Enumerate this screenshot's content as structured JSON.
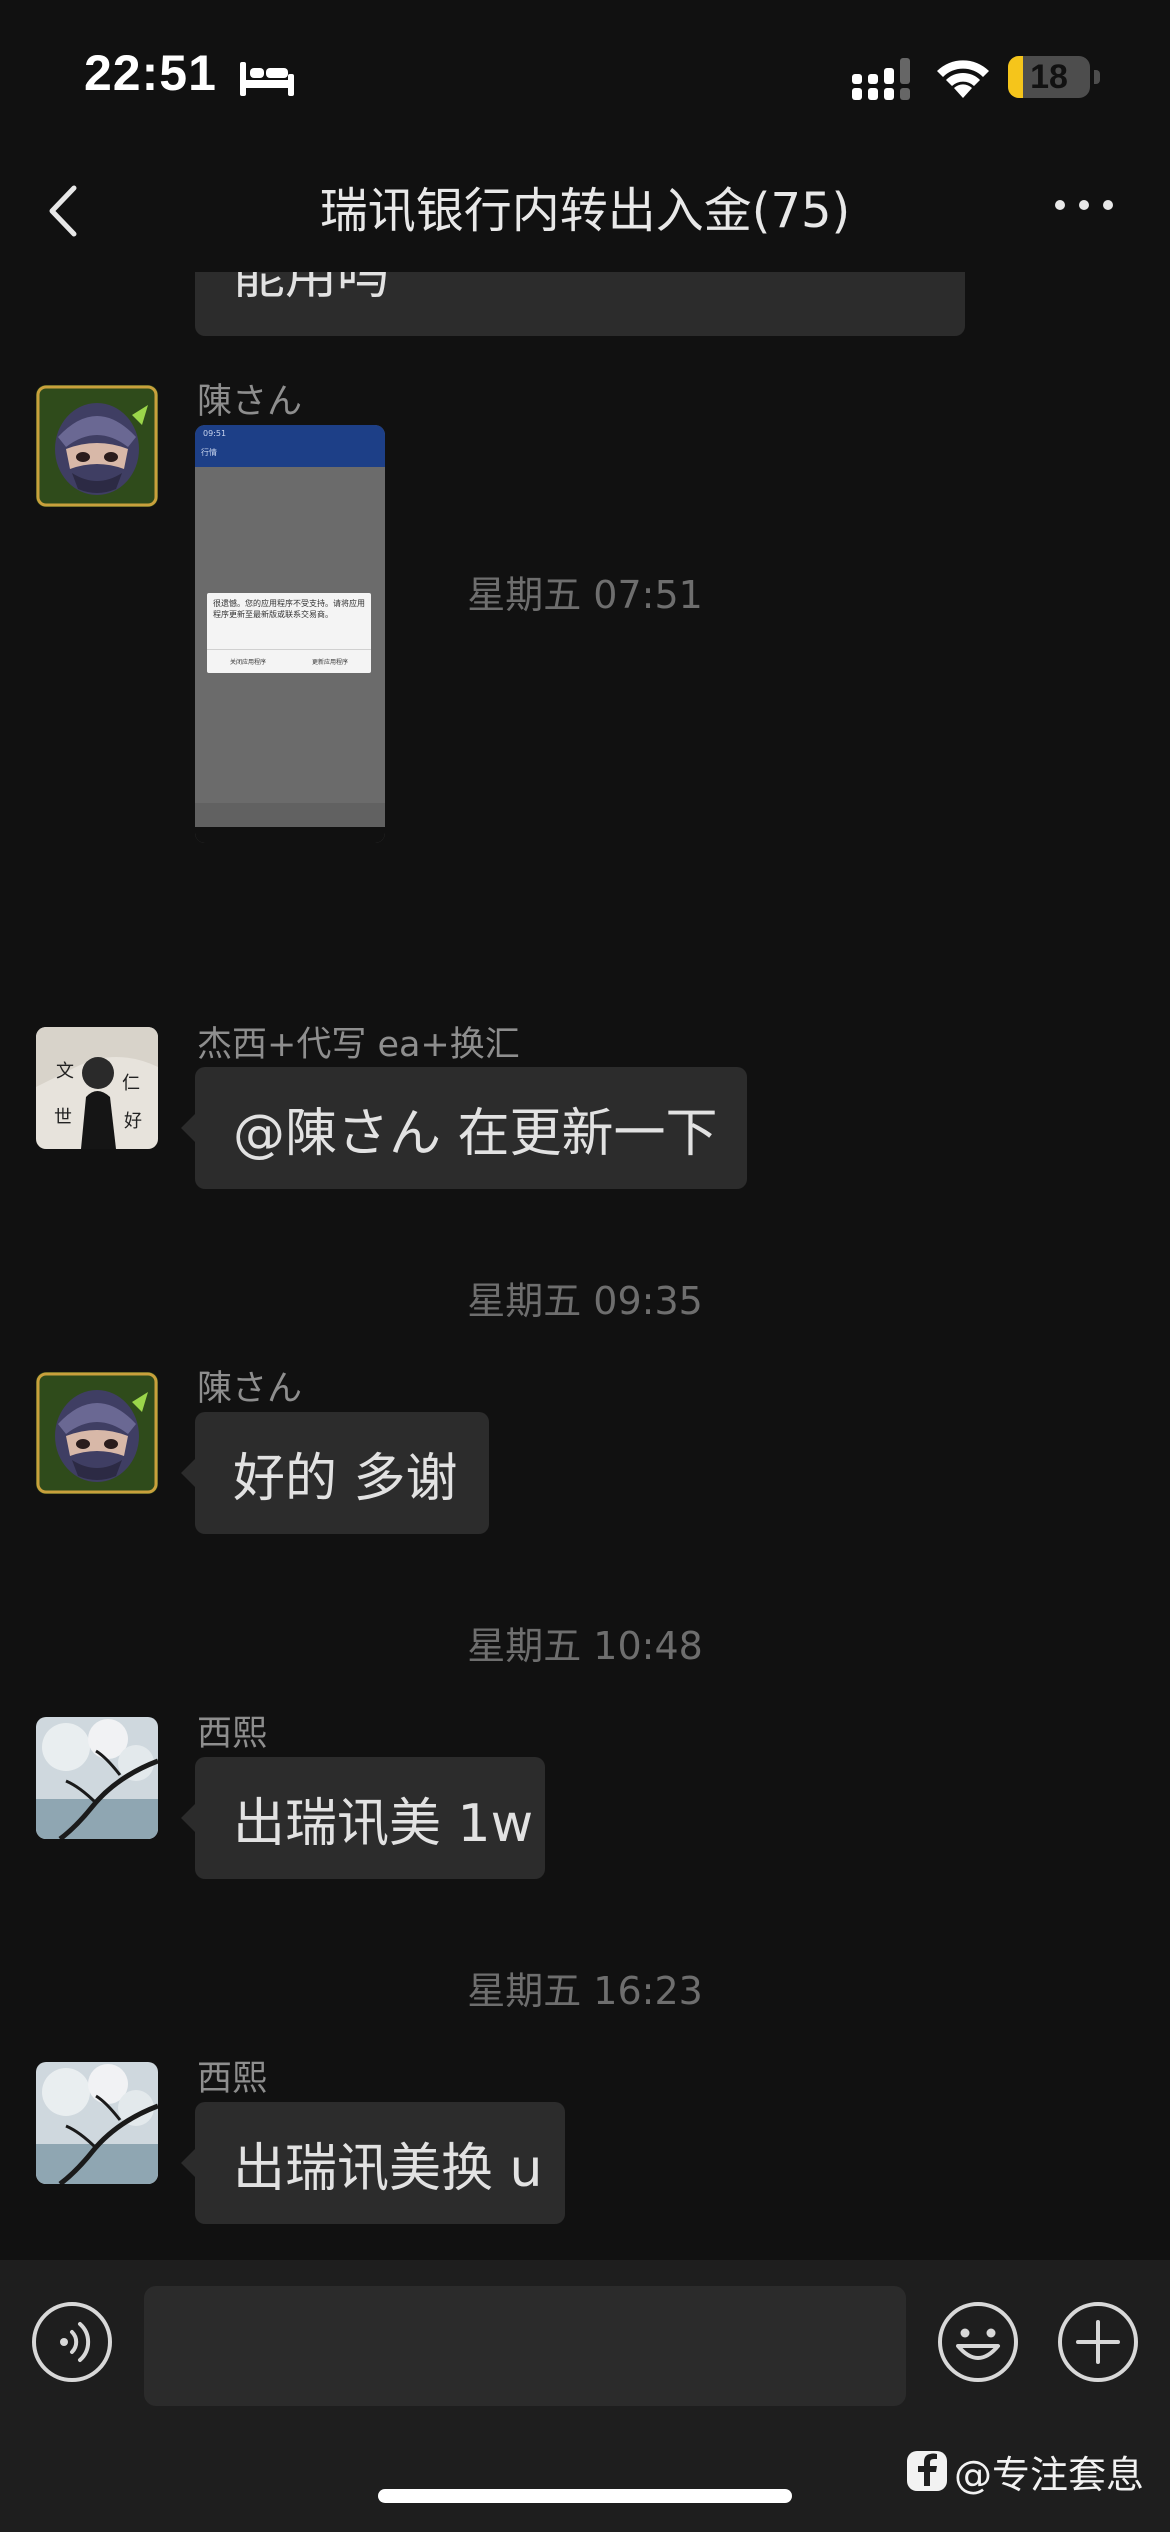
{
  "status_bar": {
    "time": "22:51",
    "battery_level": "18",
    "battery_fraction": 0.18,
    "icons": [
      "bed-icon",
      "cellular-signal-icon",
      "wifi-icon",
      "battery-icon"
    ]
  },
  "nav": {
    "title": "瑞讯银行内转出入金(75)",
    "back_icon": "chevron-left-icon",
    "more_icon": "more-dots-icon"
  },
  "messages": [
    {
      "type": "text",
      "sender": "",
      "text": "能用吗"
    },
    {
      "type": "image",
      "sender": "陳さん",
      "image": {
        "status_time": "09:51",
        "app_header": "行情",
        "dialog_text": "很遗憾。您的应用程序不受支持。请将应用程序更新至最新版或联系交易商。",
        "btn_close": "关闭应用程序",
        "btn_update": "更新应用程序"
      }
    },
    {
      "type": "timestamp",
      "text": "星期五 07:51"
    },
    {
      "type": "text",
      "sender": "杰西+代写 ea+换汇",
      "text": "@陳さん 在更新一下"
    },
    {
      "type": "timestamp",
      "text": "星期五 09:35"
    },
    {
      "type": "text",
      "sender": "陳さん",
      "text": "好的 多谢"
    },
    {
      "type": "timestamp",
      "text": "星期五 10:48"
    },
    {
      "type": "text",
      "sender": "西熙",
      "text": "出瑞讯美 1w"
    },
    {
      "type": "timestamp",
      "text": "星期五 16:23"
    },
    {
      "type": "text",
      "sender": "西熙",
      "text": "出瑞讯美换 u"
    }
  ],
  "input_bar": {
    "value": "",
    "placeholder": "",
    "voice_icon": "voice-icon",
    "emoji_icon": "emoji-icon",
    "plus_icon": "plus-icon"
  },
  "watermark": {
    "text": "@专注套息",
    "logo_icon": "platform-logo-icon"
  },
  "colors": {
    "background": "#111111",
    "bubble": "#2c2c2c",
    "input_bar": "#1e1e1e",
    "battery": "#f5c51b"
  }
}
